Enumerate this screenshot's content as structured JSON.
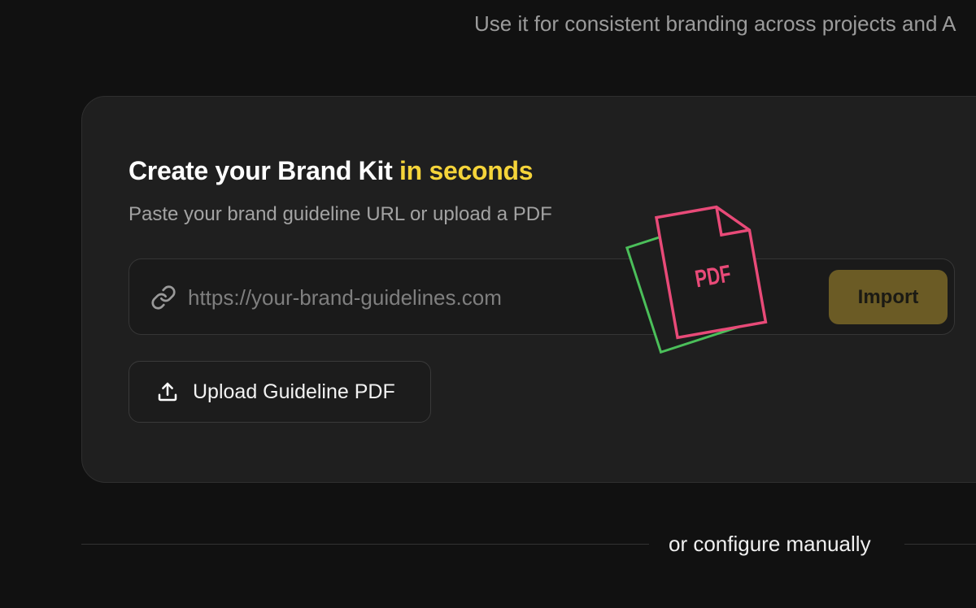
{
  "intro": {
    "subtext": "Use it for consistent branding across projects and A"
  },
  "card": {
    "heading_main": "Create your Brand Kit ",
    "heading_accent": "in seconds",
    "subheading": "Paste your brand guideline URL or upload a PDF",
    "url_input": {
      "placeholder": "https://your-brand-guidelines.com",
      "value": ""
    },
    "import_label": "Import",
    "upload_label": "Upload Guideline PDF",
    "pdf_badge_text": "PDF"
  },
  "divider": {
    "label": "or configure manually"
  },
  "icons": {
    "link": "link-icon",
    "upload": "upload-icon",
    "pdf": "pdf-file-icon"
  },
  "colors": {
    "accent": "#f5d43a",
    "import_button": "#6b5b25",
    "pdf_front": "#e84a78",
    "pdf_back": "#4bbf5a"
  }
}
